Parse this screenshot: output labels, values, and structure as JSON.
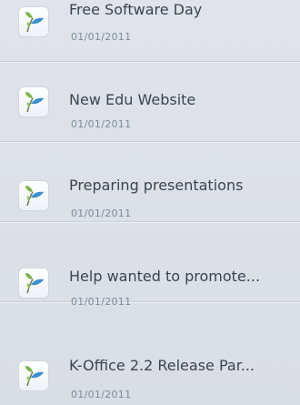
{
  "news": {
    "items": [
      {
        "title": "Free Software Day",
        "date": "01/01/2011",
        "icon": "edu-logo-icon"
      },
      {
        "title": "New Edu Website",
        "date": "01/01/2011",
        "icon": "edu-logo-icon"
      },
      {
        "title": "Preparing presentations",
        "date": "01/01/2011",
        "icon": "edu-logo-icon"
      },
      {
        "title": "Help wanted to promote...",
        "date": "01/01/2011",
        "icon": "edu-logo-icon"
      },
      {
        "title": "K-Office 2.2 Release Par...",
        "date": "01/01/2011",
        "icon": "edu-logo-icon"
      }
    ]
  },
  "colors": {
    "background": "#dde1e7",
    "title_text": "#3b4450",
    "date_text": "#7a8a9a",
    "icon_leaf_blue": "#3d8fd1",
    "icon_leaf_green": "#7ab648"
  }
}
